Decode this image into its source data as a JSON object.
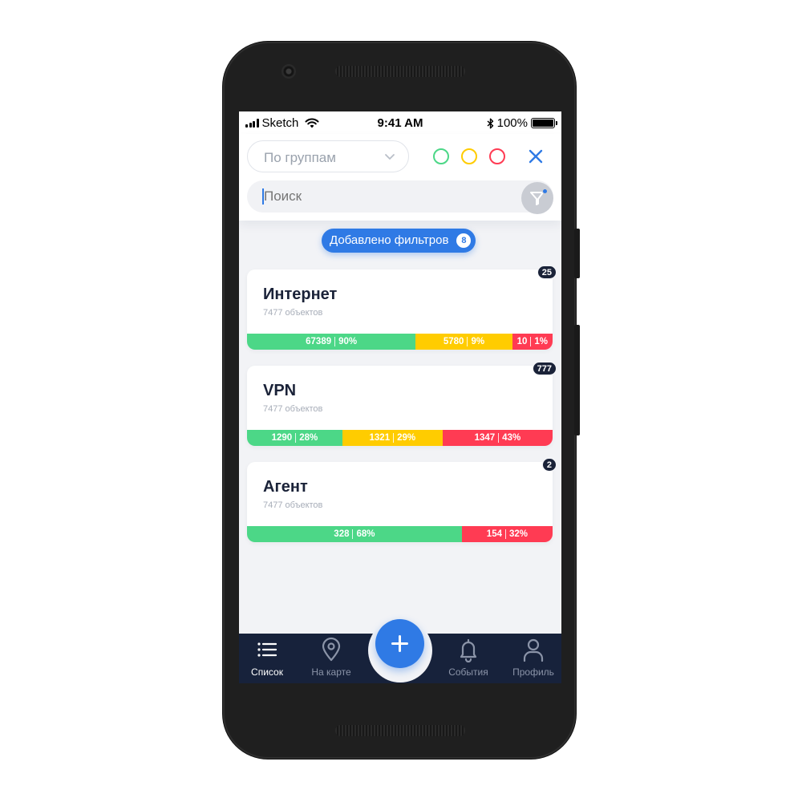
{
  "status_bar": {
    "carrier": "Sketch",
    "time": "9:41 AM",
    "battery": "100%",
    "battery_level": 1.0
  },
  "header": {
    "group_select": {
      "value": "По группам"
    },
    "status_filters": [
      "green",
      "yellow",
      "red"
    ],
    "search": {
      "placeholder": "Поиск"
    }
  },
  "filters_pill": {
    "label": "Добавлено фильтров",
    "count": "8"
  },
  "colors": {
    "accent": "#2f7ae5",
    "green": "#4cd787",
    "yellow": "#ffcc00",
    "red": "#ff3b53",
    "navy": "#17223b"
  },
  "groups": [
    {
      "title": "Интернет",
      "subtitle": "7477 объектов",
      "badge": "25",
      "segments": [
        {
          "color": "green",
          "count": "67389",
          "percent": "90%",
          "share": 0.552
        },
        {
          "color": "yellow",
          "count": "5780",
          "percent": "9%",
          "share": 0.316
        },
        {
          "color": "red",
          "count": "10",
          "percent": "1%",
          "share": 0.132
        }
      ]
    },
    {
      "title": "VPN",
      "subtitle": "7477 объектов",
      "badge": "777",
      "segments": [
        {
          "color": "green",
          "count": "1290",
          "percent": "28%",
          "share": 0.312
        },
        {
          "color": "yellow",
          "count": "1321",
          "percent": "29%",
          "share": 0.328
        },
        {
          "color": "red",
          "count": "1347",
          "percent": "43%",
          "share": 0.36
        }
      ]
    },
    {
      "title": "Агент",
      "subtitle": "7477 объектов",
      "badge": "2",
      "segments": [
        {
          "color": "green",
          "count": "328",
          "percent": "68%",
          "share": 0.703
        },
        {
          "color": "red",
          "count": "154",
          "percent": "32%",
          "share": 0.297
        }
      ]
    }
  ],
  "tabbar": {
    "items": [
      {
        "label": "Список",
        "icon": "list-icon",
        "active": true
      },
      {
        "label": "На карте",
        "icon": "map-pin-icon",
        "active": false
      },
      {
        "label": "События",
        "icon": "bell-icon",
        "active": false
      },
      {
        "label": "Профиль",
        "icon": "user-icon",
        "active": false
      }
    ],
    "fab_icon": "plus-icon"
  }
}
